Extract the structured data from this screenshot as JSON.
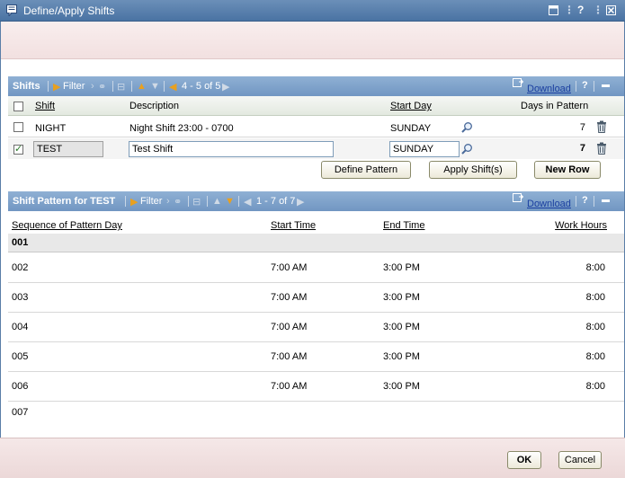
{
  "window": {
    "title": "Define/Apply Shifts",
    "help": "?",
    "close": "X"
  },
  "shifts": {
    "title": "Shifts",
    "filter": "Filter",
    "range": "4 - 5 of 5",
    "download": "Download",
    "help": "?",
    "columns": {
      "shift": "Shift",
      "description": "Description",
      "start_day": "Start Day",
      "days": "Days in Pattern"
    },
    "rows": [
      {
        "shift": "NIGHT",
        "description": "Night Shift 23:00 - 0700",
        "start_day": "SUNDAY",
        "days": "7",
        "checked": false
      },
      {
        "shift": "TEST",
        "description": "Test Shift",
        "start_day": "SUNDAY",
        "days": "7",
        "checked": true
      }
    ],
    "buttons": {
      "define": "Define Pattern",
      "apply": "Apply Shift(s)",
      "new_row": "New Row"
    }
  },
  "pattern": {
    "title": "Shift Pattern for TEST",
    "filter": "Filter",
    "range": "1 - 7 of 7",
    "download": "Download",
    "help": "?",
    "columns": {
      "seq": "Sequence of Pattern Day",
      "start": "Start Time",
      "end": "End Time",
      "hours": "Work Hours"
    },
    "rows": [
      {
        "seq": "001",
        "start": "",
        "end": "",
        "hours": ""
      },
      {
        "seq": "002",
        "start": "7:00 AM",
        "end": "3:00 PM",
        "hours": "8:00"
      },
      {
        "seq": "003",
        "start": "7:00 AM",
        "end": "3:00 PM",
        "hours": "8:00"
      },
      {
        "seq": "004",
        "start": "7:00 AM",
        "end": "3:00 PM",
        "hours": "8:00"
      },
      {
        "seq": "005",
        "start": "7:00 AM",
        "end": "3:00 PM",
        "hours": "8:00"
      },
      {
        "seq": "006",
        "start": "7:00 AM",
        "end": "3:00 PM",
        "hours": "8:00"
      },
      {
        "seq": "007",
        "start": "",
        "end": "",
        "hours": ""
      }
    ]
  },
  "footer": {
    "ok": "OK",
    "cancel": "Cancel"
  },
  "colors": {
    "title_bar": "#4a73a3",
    "section_bar": "#7e9fc8",
    "accent_orange": "#e8a020",
    "link": "#1a3fa0",
    "check": "#2a7a2a"
  },
  "icons": [
    "dialog-icon",
    "restore-icon",
    "help-icon",
    "close-icon",
    "filter-arrow-icon",
    "binoculars-icon",
    "columns-icon",
    "move-up-icon",
    "move-down-icon",
    "prev-page-icon",
    "next-page-icon",
    "download-icon",
    "minimize-icon",
    "magnifier-icon",
    "trash-icon"
  ]
}
